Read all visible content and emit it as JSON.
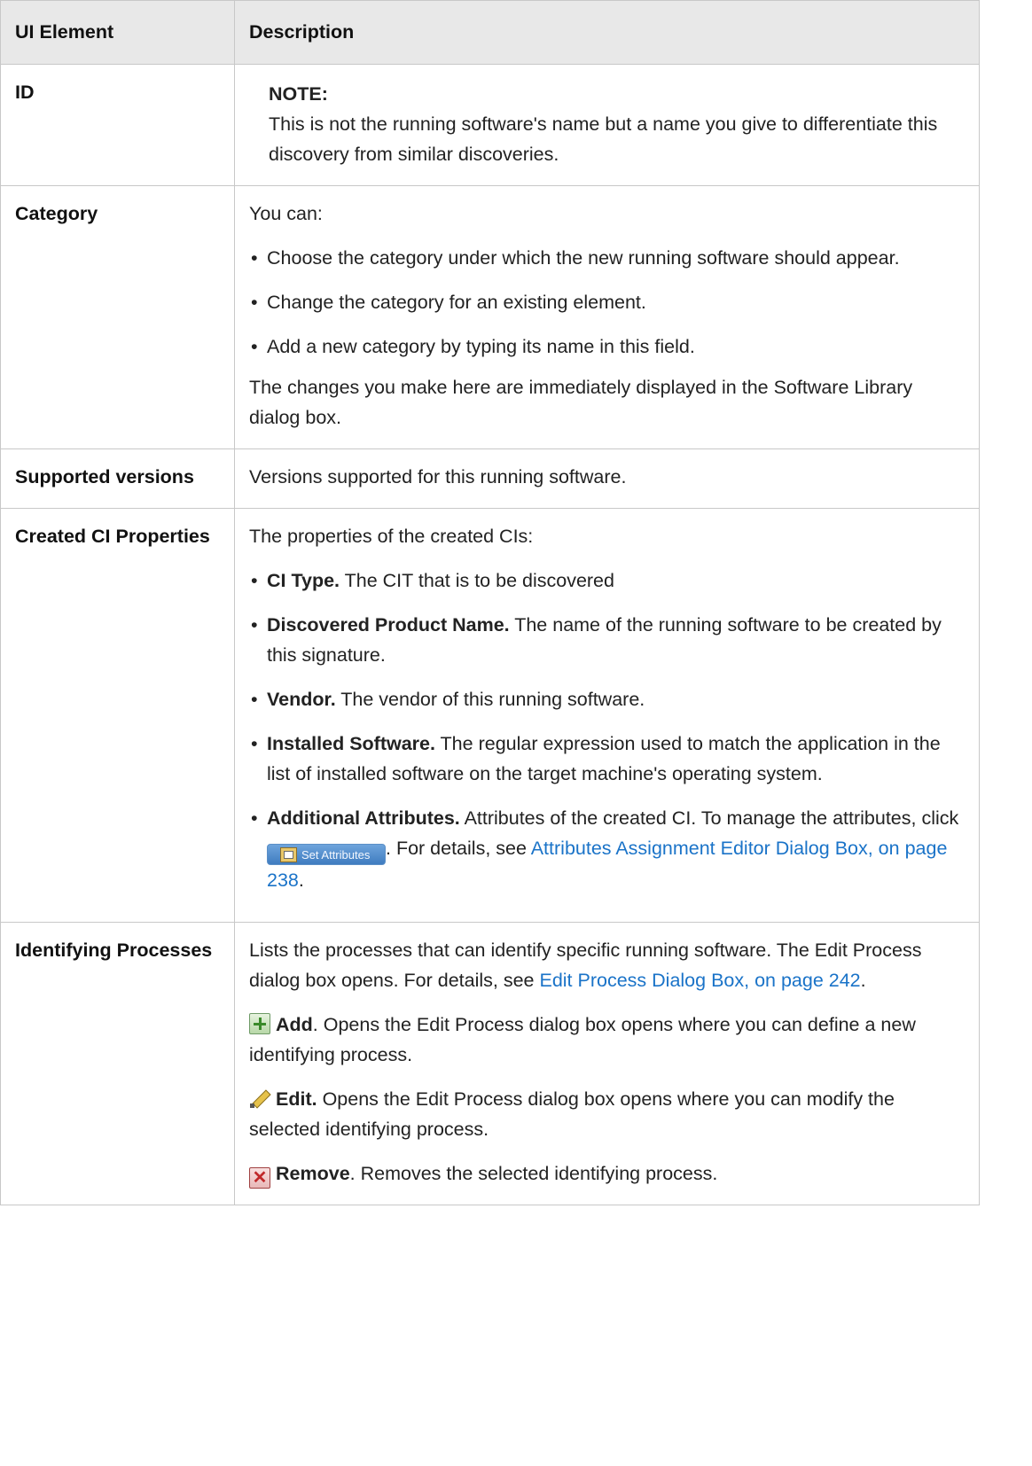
{
  "header": {
    "col1": "UI Element",
    "col2": "Description"
  },
  "rows": {
    "id": {
      "element": "ID",
      "note_title": "NOTE:",
      "note_text": "This is not the running software's name but a name you give to differentiate this discovery from similar discoveries."
    },
    "category": {
      "element": "Category",
      "intro": "You can:",
      "bullets": [
        "Choose the category under which the new running software should appear.",
        "Change the category for an existing element.",
        "Add a new category by typing its name in this field."
      ],
      "outro": "The changes you make here are immediately displayed in the Software Library dialog box."
    },
    "versions": {
      "element": "Supported versions",
      "text": "Versions supported for this running software."
    },
    "created_ci": {
      "element": "Created CI Properties",
      "intro": "The properties of the created CIs:",
      "items": [
        {
          "term": "CI Type.",
          "text": " The CIT that is to be discovered"
        },
        {
          "term": "Discovered Product Name.",
          "text": " The name of the running software to be created by this signature."
        },
        {
          "term": "Vendor.",
          "text": " The vendor of this running software."
        },
        {
          "term": "Installed Software.",
          "text": " The regular expression used to match the application in the list of installed software on the target machine's operating system."
        },
        {
          "term": "Additional Attributes.",
          "text": " Attributes of the created CI. To manage the attributes, click "
        }
      ],
      "set_attributes_button": "Set Attributes",
      "after_button": ". For details, see ",
      "link": "Attributes Assignment Editor Dialog Box, on page 238",
      "end": "."
    },
    "identifying": {
      "element": "Identifying Processes",
      "intro": "Lists the processes that can identify specific running software. The Edit Process dialog box opens. For details, see ",
      "link": "Edit Process Dialog Box, on page 242",
      "intro_end": ".",
      "add_term": "Add",
      "add_text": ". Opens the Edit Process dialog box opens where you can define a new identifying process.",
      "edit_term": "Edit.",
      "edit_text": " Opens the Edit Process dialog box opens where you can modify the selected identifying process.",
      "remove_term": "Remove",
      "remove_text": ". Removes the selected identifying process."
    }
  },
  "icons": {
    "bullet": "•",
    "add": "add-icon",
    "edit": "edit-pencil-icon",
    "remove": "remove-x-icon"
  },
  "colors": {
    "link": "#1a73c8",
    "header_bg": "#e8e8e8",
    "border": "#c8c8c8"
  }
}
